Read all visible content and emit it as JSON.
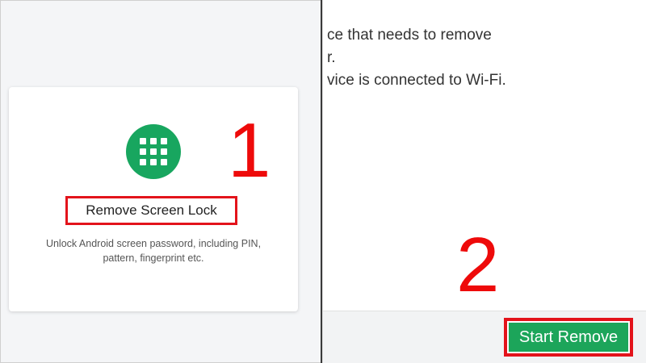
{
  "colors": {
    "accent_green": "#18a65f",
    "highlight_red": "#e3131b",
    "step_number_red": "#ee0a0a"
  },
  "left": {
    "card": {
      "icon": "keypad-grid-icon",
      "title": "Remove Screen Lock",
      "description_line1": "Unlock Android screen password, including PIN,",
      "description_line2": "pattern, fingerprint etc."
    },
    "step_number": "1"
  },
  "right": {
    "instructions": [
      "ce that needs to remove",
      "r.",
      "vice is connected to Wi-Fi."
    ],
    "start_button_label": "Start Remove",
    "step_number": "2"
  }
}
